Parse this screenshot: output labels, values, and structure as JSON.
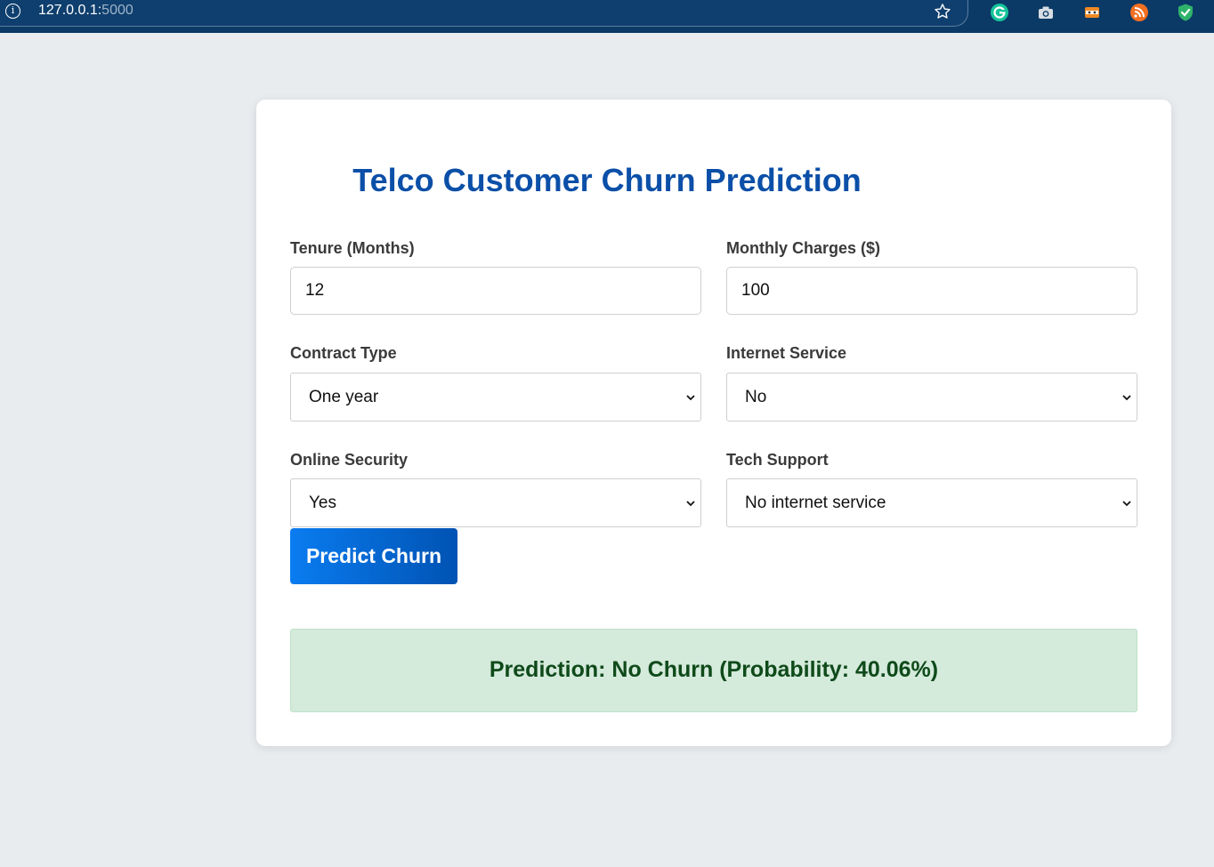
{
  "browser": {
    "url_host": "127.0.0.1:",
    "url_port": "5000",
    "extensions": [
      "grammarly-icon",
      "camera-icon",
      "mask-icon",
      "rss-icon",
      "shield-check-icon"
    ]
  },
  "page": {
    "title": "Telco Customer Churn Prediction"
  },
  "form": {
    "tenure": {
      "label": "Tenure (Months)",
      "value": "12"
    },
    "monthly_charges": {
      "label": "Monthly Charges ($)",
      "value": "100"
    },
    "contract": {
      "label": "Contract Type",
      "selected": "One year"
    },
    "internet": {
      "label": "Internet Service",
      "selected": "No"
    },
    "security": {
      "label": "Online Security",
      "selected": "Yes"
    },
    "tech_support": {
      "label": "Tech Support",
      "selected": "No internet service"
    },
    "submit_label": "Predict Churn"
  },
  "result": {
    "text": "Prediction: No Churn (Probability: 40.06%)"
  },
  "colors": {
    "title": "#0b4fa8",
    "button_start": "#0a7cf0",
    "button_end": "#0053b3",
    "result_bg": "#d4eadb",
    "result_text": "#0f4a1a"
  }
}
